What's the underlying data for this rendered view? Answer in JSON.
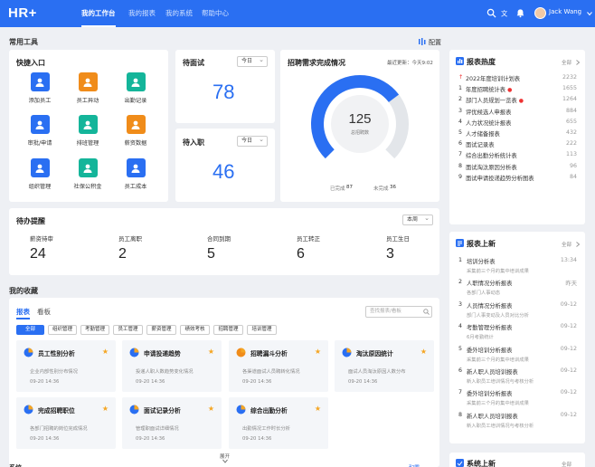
{
  "app": {
    "logo": "HR+",
    "user": "Jack Wang"
  },
  "nav": [
    "我的工作台",
    "我的报表",
    "我的系统",
    "帮助中心"
  ],
  "common_tools": {
    "title": "常用工具",
    "config": "配置"
  },
  "quick": {
    "title": "快捷入口",
    "items": [
      {
        "label": "添加员工",
        "color": "#2a6ff2",
        "icon": "add-user-icon"
      },
      {
        "label": "员工异动",
        "color": "#f08c1a",
        "icon": "user-change-icon"
      },
      {
        "label": "出勤记录",
        "color": "#14b59a",
        "icon": "calendar-icon"
      },
      {
        "label": "审批/申请",
        "color": "#2a6ff2",
        "icon": "approval-icon"
      },
      {
        "label": "排班管理",
        "color": "#14b59a",
        "icon": "schedule-icon"
      },
      {
        "label": "薪资数据",
        "color": "#f08c1a",
        "icon": "salary-icon"
      },
      {
        "label": "组织管理",
        "color": "#2a6ff2",
        "icon": "org-icon"
      },
      {
        "label": "社保公积金",
        "color": "#14b59a",
        "icon": "house-icon"
      },
      {
        "label": "员工成本",
        "color": "#2a6ff2",
        "icon": "cost-icon"
      }
    ]
  },
  "interview": {
    "title": "待面试",
    "select": "今日",
    "value": "78"
  },
  "onboard": {
    "title": "待入职",
    "select": "今日",
    "value": "46"
  },
  "recruit": {
    "title": "招聘需求完成情况",
    "updated": "最近更新：今天9:02",
    "total": "125",
    "total_label": "总招聘数",
    "done_label": "已完成",
    "done": "87",
    "undone_label": "未完成",
    "undone": "36"
  },
  "todo": {
    "title": "待办提醒",
    "select": "本周",
    "items": [
      {
        "label": "薪资待审",
        "value": "24"
      },
      {
        "label": "员工离职",
        "value": "2"
      },
      {
        "label": "合同到期",
        "value": "5"
      },
      {
        "label": "员工转正",
        "value": "6"
      },
      {
        "label": "员工生日",
        "value": "3"
      }
    ]
  },
  "favorites": {
    "title": "我的收藏",
    "tabs": [
      "报表",
      "看板"
    ],
    "search_placeholder": "查找报表/看板",
    "chips": [
      "全部",
      "组织管理",
      "考勤管理",
      "员工管理",
      "薪资管理",
      "绩效考核",
      "招聘管理",
      "培训管理"
    ],
    "items": [
      {
        "name": "员工性别分析",
        "desc": "企业内部性别分布情况",
        "date": "09-20  14:36",
        "icon": "pie-icon"
      },
      {
        "name": "申请投递趋势",
        "desc": "投递人职人数趋势变化情况",
        "date": "09-20  14:36",
        "icon": "bar-icon"
      },
      {
        "name": "招聘漏斗分析",
        "desc": "各渠道面试人员聘转化情况",
        "date": "09-20  14:36",
        "icon": "funnel-icon"
      },
      {
        "name": "淘汰原因统计",
        "desc": "面试人员淘汰原因人数分布",
        "date": "09-20  14:36",
        "icon": "bar-icon"
      },
      {
        "name": "完成招聘职位",
        "desc": "各部门招聘的岗位完成情况",
        "date": "09-20  14:36",
        "icon": "pie-icon"
      },
      {
        "name": "面试记录分析",
        "desc": "管理职面试详细情况",
        "date": "09-20  14:36",
        "icon": "bar-icon"
      },
      {
        "name": "综合出勤分析",
        "desc": "出勤情况工作时长分析",
        "date": "09-20  14:36",
        "icon": "line-icon"
      }
    ],
    "expand": "展开"
  },
  "hot": {
    "title": "报表热度",
    "more": "全部",
    "items": [
      {
        "n": "",
        "t": "2022年度培训计划表",
        "v": "2232"
      },
      {
        "n": "1",
        "t": "年度招聘统计表",
        "v": "1655"
      },
      {
        "n": "2",
        "t": "部门人员规划一览表",
        "v": "1264"
      },
      {
        "n": "3",
        "t": "评优候选人申报表",
        "v": "884"
      },
      {
        "n": "4",
        "t": "人力状况统计报表",
        "v": "655"
      },
      {
        "n": "5",
        "t": "人才储备报表",
        "v": "432"
      },
      {
        "n": "6",
        "t": "面试记录表",
        "v": "222"
      },
      {
        "n": "7",
        "t": "综合出勤分析统计表",
        "v": "113"
      },
      {
        "n": "8",
        "t": "面试淘汰原因分析表",
        "v": "96"
      },
      {
        "n": "9",
        "t": "面试申请投递趋势分析图表",
        "v": "84"
      }
    ]
  },
  "newr": {
    "title": "报表上新",
    "more": "全部",
    "items": [
      {
        "n": "1",
        "t": "培训分析表",
        "d": "采集前三个月的集中培训成果",
        "v": "13:34"
      },
      {
        "n": "2",
        "t": "人职情况分析报表",
        "d": "各部门人事动态",
        "v": "昨天"
      },
      {
        "n": "3",
        "t": "人员情况分析报表",
        "d": "部门人事变动及人员对比分析",
        "v": "09-12"
      },
      {
        "n": "4",
        "t": "考勤管理分析报表",
        "d": "6月考勤统计",
        "v": "09-12"
      },
      {
        "n": "5",
        "t": "委外培训分析报表",
        "d": "采集前三个月的集中培训成果",
        "v": "09-12"
      },
      {
        "n": "6",
        "t": "新人职人员培训报表",
        "d": "新入职员工培训情况与考核分析",
        "v": "09-12"
      },
      {
        "n": "7",
        "t": "委外培训分析报表",
        "d": "采集前三个月的集中培训成果",
        "v": "09-12"
      },
      {
        "n": "8",
        "t": "新人职人员培训报表",
        "d": "新入职员工培训情况与考核分析",
        "v": "09-12"
      }
    ]
  },
  "sysnew": {
    "title": "系统上新",
    "more": "全部"
  },
  "bottom": {
    "left": "系统",
    "right": "配置"
  }
}
